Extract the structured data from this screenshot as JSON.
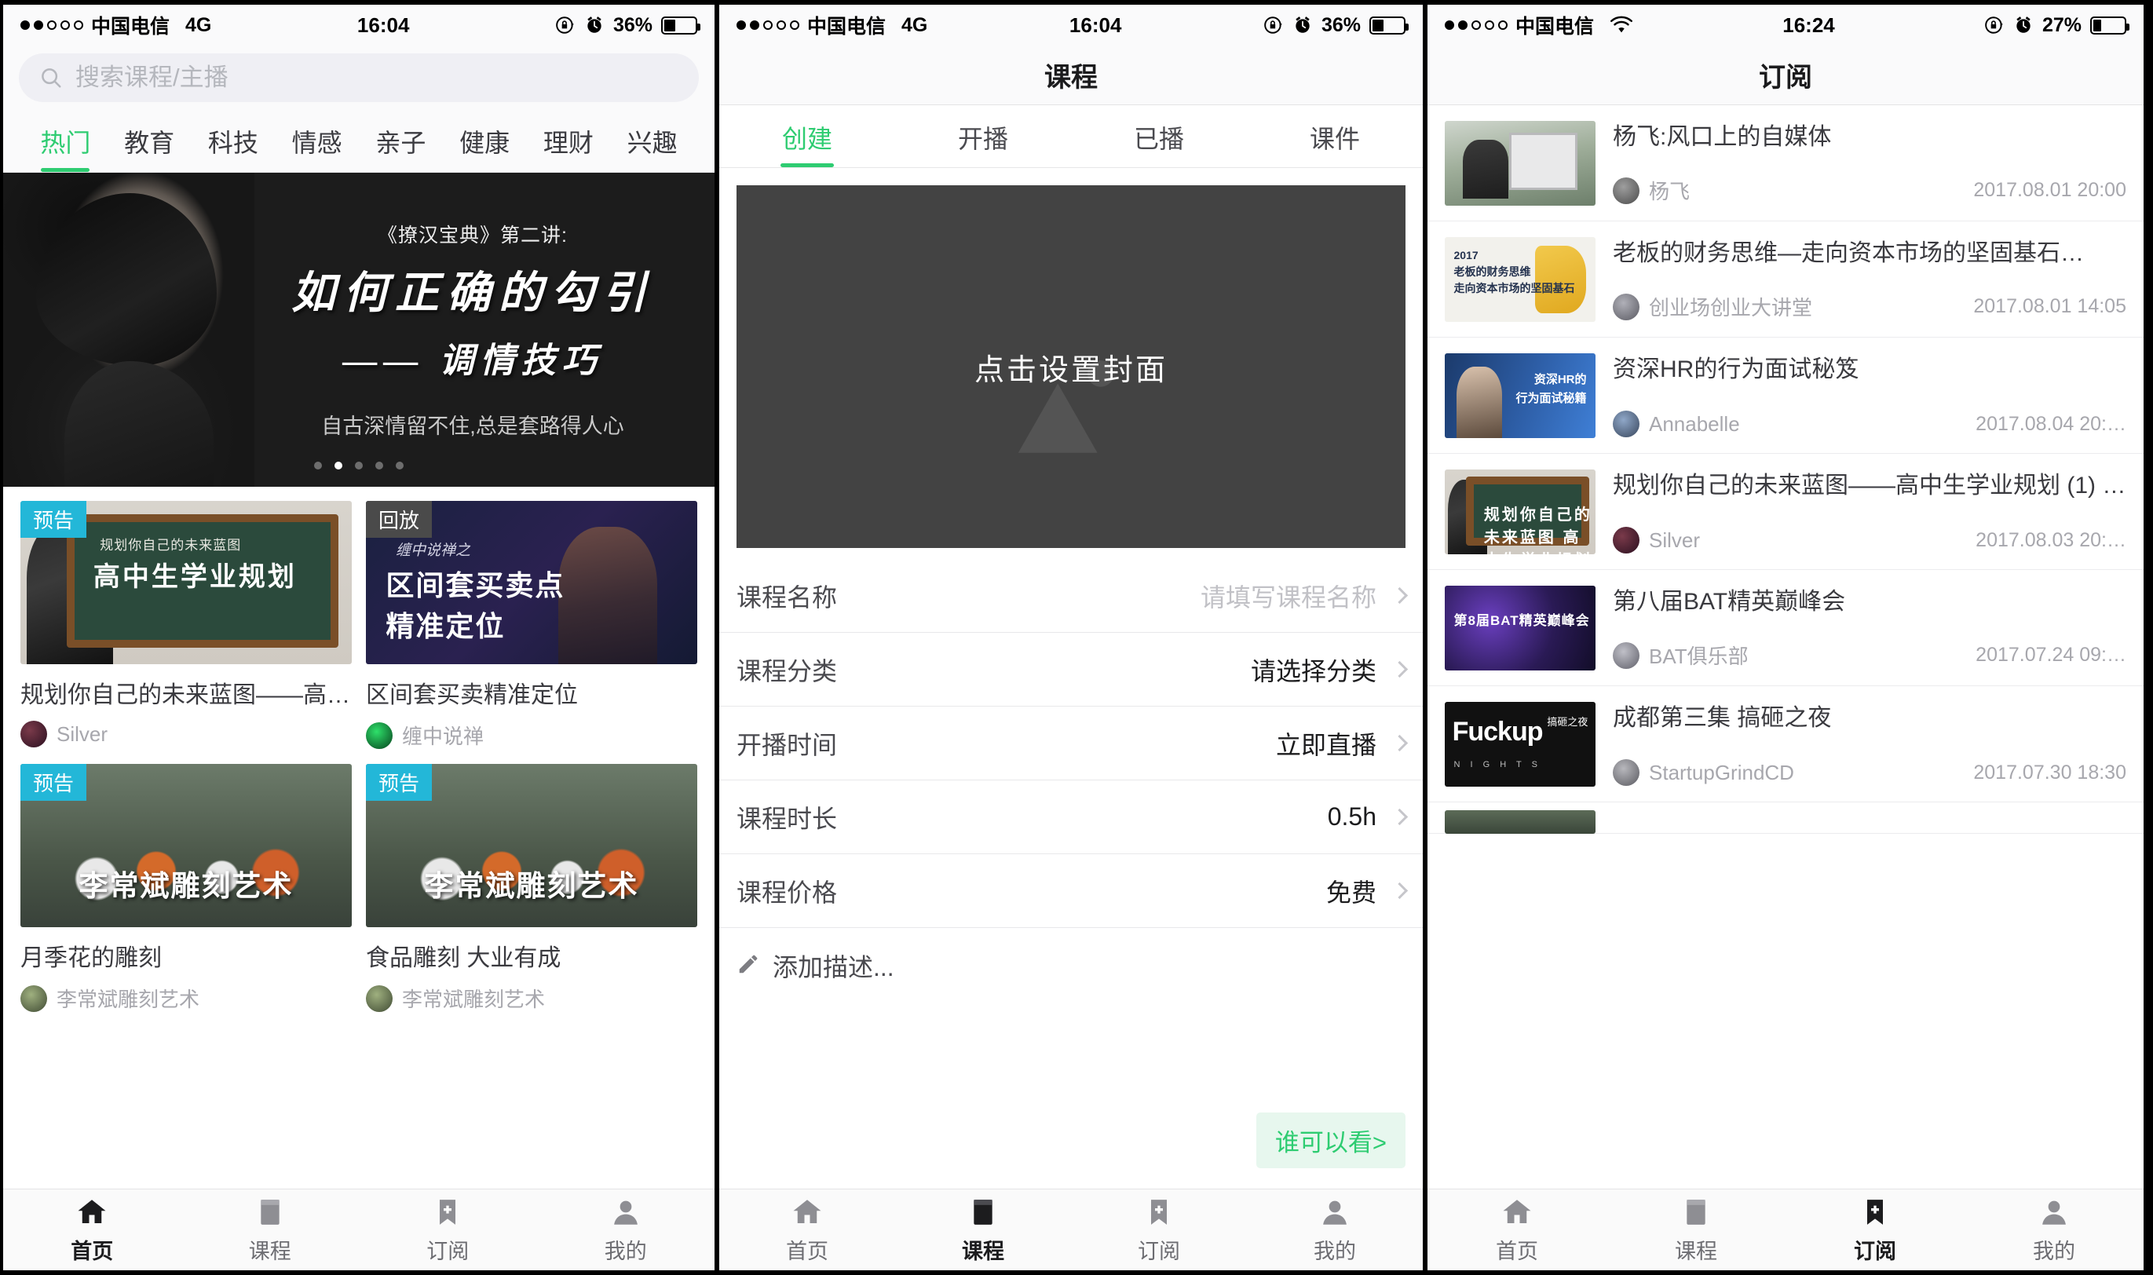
{
  "panel1": {
    "status": {
      "carrier": "中国电信",
      "network": "4G",
      "time": "16:04",
      "battery": "36%",
      "signal_filled": 2,
      "signal_total": 5
    },
    "search": {
      "placeholder": "搜索课程/主播",
      "icon": "search-icon"
    },
    "category_tabs": [
      {
        "label": "热门",
        "active": true
      },
      {
        "label": "教育",
        "active": false
      },
      {
        "label": "科技",
        "active": false
      },
      {
        "label": "情感",
        "active": false
      },
      {
        "label": "亲子",
        "active": false
      },
      {
        "label": "健康",
        "active": false
      },
      {
        "label": "理财",
        "active": false
      },
      {
        "label": "兴趣",
        "active": false
      }
    ],
    "banner": {
      "kicker": "《撩汉宝典》第二讲:",
      "title": "如何正确的勾引",
      "subtitle": "—— 调情技巧",
      "tagline": "自古深情留不住,总是套路得人心",
      "dots": 5,
      "active_dot": 1
    },
    "cards": [
      {
        "badge": "预告",
        "badge_type": "pre",
        "art": "board",
        "art_line1": "规划你自己的未来蓝图",
        "art_line2": "高中生学业规划",
        "title": "规划你自己的未来蓝图——高…",
        "author": "Silver"
      },
      {
        "badge": "回放",
        "badge_type": "rep",
        "art": "dark",
        "art_line0": "缠中说禅之",
        "art_line1": "区间套买卖点",
        "art_line2": "精准定位",
        "title": "区间套买卖精准定位",
        "author": "缠中说禅"
      },
      {
        "badge": "预告",
        "badge_type": "pre",
        "art": "panda",
        "art_line1": "李常斌雕刻艺术",
        "title": "月季花的雕刻",
        "author": "李常斌雕刻艺术"
      },
      {
        "badge": "预告",
        "badge_type": "pre",
        "art": "panda",
        "art_line1": "李常斌雕刻艺术",
        "title": "食品雕刻  大业有成",
        "author": "李常斌雕刻艺术"
      }
    ],
    "tabbar": [
      {
        "label": "首页",
        "icon": "home-icon",
        "active": true
      },
      {
        "label": "课程",
        "icon": "book-icon",
        "active": false
      },
      {
        "label": "订阅",
        "icon": "bookmark-icon",
        "active": false
      },
      {
        "label": "我的",
        "icon": "person-icon",
        "active": false
      }
    ]
  },
  "panel2": {
    "status": {
      "carrier": "中国电信",
      "network": "4G",
      "time": "16:04",
      "battery": "36%",
      "signal_filled": 2,
      "signal_total": 5
    },
    "navbar_title": "课程",
    "tabs": [
      {
        "label": "创建",
        "active": true
      },
      {
        "label": "开播",
        "active": false
      },
      {
        "label": "已播",
        "active": false
      },
      {
        "label": "课件",
        "active": false
      }
    ],
    "cover": {
      "label": "点击设置封面",
      "icon": "image-placeholder-icon"
    },
    "form": [
      {
        "label": "课程名称",
        "value": "请填写课程名称",
        "is_placeholder": true
      },
      {
        "label": "课程分类",
        "value": "请选择分类",
        "is_placeholder": false
      },
      {
        "label": "开播时间",
        "value": "立即直播",
        "is_placeholder": false
      },
      {
        "label": "课程时长",
        "value": "0.5h",
        "is_placeholder": false
      },
      {
        "label": "课程价格",
        "value": "免费",
        "is_placeholder": false
      }
    ],
    "description_row": {
      "label": "添加描述...",
      "icon": "pencil-icon"
    },
    "who_can_see": "谁可以看>",
    "tabbar": [
      {
        "label": "首页",
        "icon": "home-icon",
        "active": false
      },
      {
        "label": "课程",
        "icon": "book-icon",
        "active": true
      },
      {
        "label": "订阅",
        "icon": "bookmark-icon",
        "active": false
      },
      {
        "label": "我的",
        "icon": "person-icon",
        "active": false
      }
    ]
  },
  "panel3": {
    "status": {
      "carrier": "中国电信",
      "network": "wifi",
      "time": "16:24",
      "battery": "27%",
      "signal_filled": 2,
      "signal_total": 5
    },
    "navbar_title": "订阅",
    "items": [
      {
        "title": "杨飞:风口上的自媒体",
        "author": "杨飞",
        "time": "2017.08.01 20:00",
        "art": "office"
      },
      {
        "title": "老板的财务思维—走向资本市场的坚固基石…",
        "author": "创业场创业大讲堂",
        "time": "2017.08.01 14:05",
        "art": "fin",
        "art_text": "2017\n老板的财务思维\n走向资本市场的坚固基石"
      },
      {
        "title": "资深HR的行为面试秘笈",
        "author": "Annabelle",
        "time": "2017.08.04 20:…",
        "art": "hr",
        "art_text": "资深HR的\n行为面试秘籍"
      },
      {
        "title": "规划你自己的未来蓝图——高中生学业规划 (1) …",
        "author": "Silver",
        "time": "2017.08.03 20:…",
        "art": "board",
        "art_text": "规划你自己的未来蓝图\n高中生学业规划"
      },
      {
        "title": "第八届BAT精英巅峰会",
        "author": "BAT俱乐部",
        "time": "2017.07.24 09:…",
        "art": "bat",
        "art_text": "第8届BAT精英巅峰会"
      },
      {
        "title": "成都第三集 搞砸之夜",
        "author": "StartupGrindCD",
        "time": "2017.07.30 18:30",
        "art": "fk",
        "art_text": "Fuckup",
        "art_text2": "N I G H T S",
        "art_text3": "搞砸之夜"
      }
    ],
    "tabbar": [
      {
        "label": "首页",
        "icon": "home-icon",
        "active": false
      },
      {
        "label": "课程",
        "icon": "book-icon",
        "active": false
      },
      {
        "label": "订阅",
        "icon": "bookmark-icon",
        "active": true
      },
      {
        "label": "我的",
        "icon": "person-icon",
        "active": false
      }
    ]
  },
  "colors": {
    "accent": "#2ecc71",
    "badge_pre": "#23b7d8",
    "badge_replay": "#4a4a4a",
    "text_primary": "#3a3a3f",
    "text_muted": "#a7a7ad"
  }
}
